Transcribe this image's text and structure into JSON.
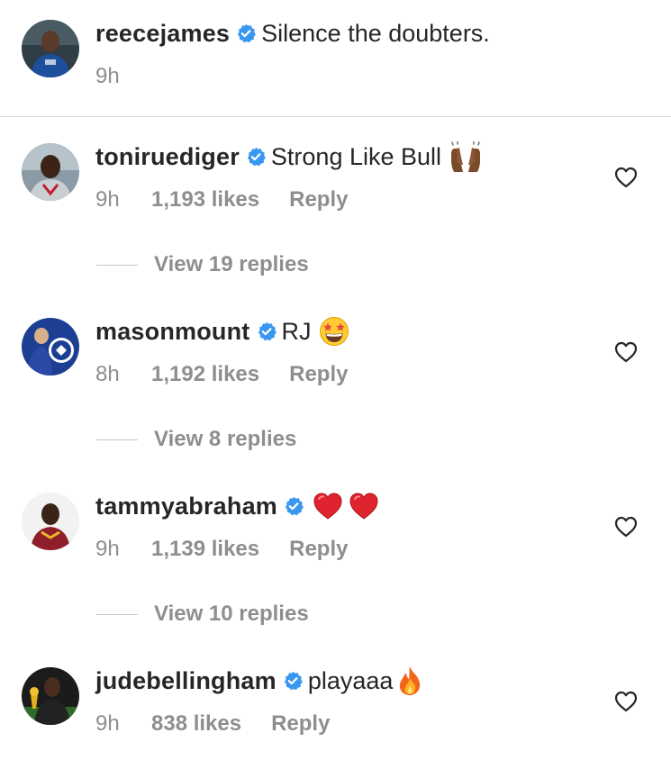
{
  "caption": {
    "username": "reecejames",
    "text": "Silence the doubters.",
    "time": "9h"
  },
  "comments": [
    {
      "username": "toniruediger",
      "text": "Strong Like Bull",
      "emoji": "raising-hands-icon",
      "time": "9h",
      "likes": "1,193 likes",
      "reply": "Reply",
      "view_replies": "View 19 replies"
    },
    {
      "username": "masonmount",
      "text": "RJ",
      "emoji": "star-struck-icon",
      "time": "8h",
      "likes": "1,192 likes",
      "reply": "Reply",
      "view_replies": "View 8 replies"
    },
    {
      "username": "tammyabraham",
      "text": "",
      "emoji": "red-heart-icon",
      "time": "9h",
      "likes": "1,139 likes",
      "reply": "Reply",
      "view_replies": "View 10 replies"
    },
    {
      "username": "judebellingham",
      "text": "playaaa",
      "emoji": "fire-icon",
      "time": "9h",
      "likes": "838 likes",
      "reply": "Reply"
    }
  ],
  "colors": {
    "verified": "#3897f0",
    "text": "#262626",
    "meta": "#8e8e8e",
    "divider": "#dbdbdb"
  }
}
